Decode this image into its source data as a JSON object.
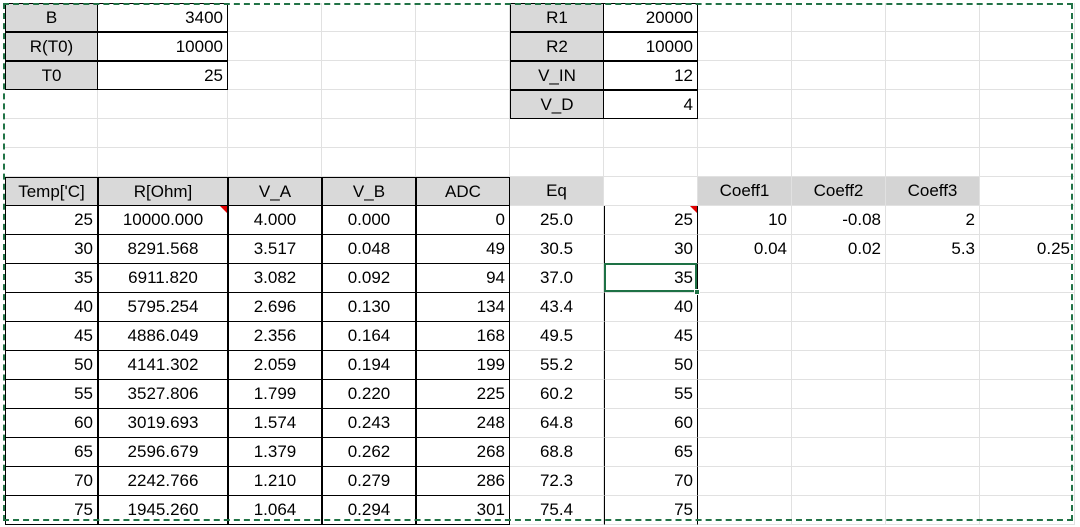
{
  "params_left": [
    {
      "label": "B",
      "value": "3400"
    },
    {
      "label": "R(T0)",
      "value": "10000"
    },
    {
      "label": "T0",
      "value": "25"
    }
  ],
  "params_right": [
    {
      "label": "R1",
      "value": "20000"
    },
    {
      "label": "R2",
      "value": "10000"
    },
    {
      "label": "V_IN",
      "value": "12"
    },
    {
      "label": "V_D",
      "value": "4"
    }
  ],
  "table": {
    "headers": [
      "Temp['C]",
      "R[Ohm]",
      "V_A",
      "V_B",
      "ADC",
      "Eq"
    ],
    "rows": [
      {
        "temp": "25",
        "r": "10000.000",
        "va": "4.000",
        "vb": "0.000",
        "adc": "0",
        "eq": "25.0",
        "ref": "25"
      },
      {
        "temp": "30",
        "r": "8291.568",
        "va": "3.517",
        "vb": "0.048",
        "adc": "49",
        "eq": "30.5",
        "ref": "30"
      },
      {
        "temp": "35",
        "r": "6911.820",
        "va": "3.082",
        "vb": "0.092",
        "adc": "94",
        "eq": "37.0",
        "ref": "35"
      },
      {
        "temp": "40",
        "r": "5795.254",
        "va": "2.696",
        "vb": "0.130",
        "adc": "134",
        "eq": "43.4",
        "ref": "40"
      },
      {
        "temp": "45",
        "r": "4886.049",
        "va": "2.356",
        "vb": "0.164",
        "adc": "168",
        "eq": "49.5",
        "ref": "45"
      },
      {
        "temp": "50",
        "r": "4141.302",
        "va": "2.059",
        "vb": "0.194",
        "adc": "199",
        "eq": "55.2",
        "ref": "50"
      },
      {
        "temp": "55",
        "r": "3527.806",
        "va": "1.799",
        "vb": "0.220",
        "adc": "225",
        "eq": "60.2",
        "ref": "55"
      },
      {
        "temp": "60",
        "r": "3019.693",
        "va": "1.574",
        "vb": "0.243",
        "adc": "248",
        "eq": "64.8",
        "ref": "60"
      },
      {
        "temp": "65",
        "r": "2596.679",
        "va": "1.379",
        "vb": "0.262",
        "adc": "268",
        "eq": "68.8",
        "ref": "65"
      },
      {
        "temp": "70",
        "r": "2242.766",
        "va": "1.210",
        "vb": "0.279",
        "adc": "286",
        "eq": "72.3",
        "ref": "70"
      },
      {
        "temp": "75",
        "r": "1945.260",
        "va": "1.064",
        "vb": "0.294",
        "adc": "301",
        "eq": "75.4",
        "ref": "75"
      }
    ]
  },
  "coeff": {
    "headers": [
      "Coeff1",
      "Coeff2",
      "Coeff3"
    ],
    "row1": [
      "10",
      "-0.08",
      "2"
    ],
    "row2": [
      "0.04",
      "0.02",
      "5.3",
      "0.25"
    ]
  },
  "colors": {
    "header_bg": "#d9d9d9",
    "selection": "#1e7145",
    "marquee": "#217346",
    "comment": "#e00000"
  }
}
